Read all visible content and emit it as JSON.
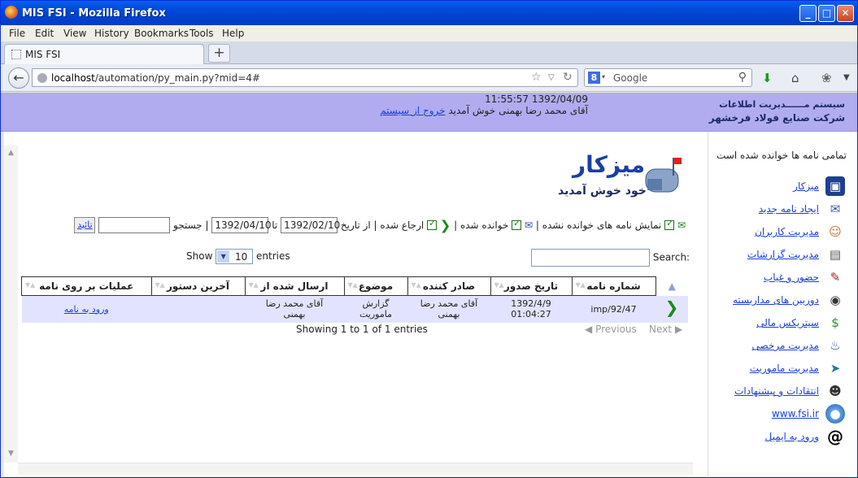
{
  "window": {
    "title": "MIS FSI - Mozilla Firefox",
    "controls": [
      "_",
      "□",
      "✕"
    ]
  },
  "menu": [
    "File",
    "Edit",
    "View",
    "History",
    "Bookmarks",
    "Tools",
    "Help"
  ],
  "tab": {
    "title": "MIS FSI",
    "new_tab": "+"
  },
  "nav": {
    "url_host": "localhost",
    "url_path": "/automation/py_main.py?mid=4#",
    "search_engine": "Google",
    "search_placeholder": "Google"
  },
  "header": {
    "clock": "11:55:57 1392/04/09",
    "welcome": "آقای محمد رضا بهمنی خوش آمدید",
    "logout": "خروج از سیستم",
    "brand_line1": "سیستم مــــــدیریت اطلاعات",
    "brand_line2": "شرکت صنایع فولاد فرخشهر"
  },
  "logo": {
    "title": "میزکار",
    "subtitle": "خود خوش آمدید"
  },
  "filter": {
    "show_unread": "نمایش نامه های خوانده نشده |",
    "read": "خوانده شده |",
    "referred": "ارجاع شده | از تاریخ",
    "from_date": "1392/02/10",
    "to": "تا",
    "to_date": "1392/04/10",
    "search_label": "| جستجو",
    "ok": "تائید"
  },
  "datatable": {
    "show": "Show",
    "page_size": "10",
    "entries": "entries",
    "search_label": "Search:",
    "columns": [
      "شماره نامه",
      "تاریخ صدور",
      "صادر کننده",
      "موضوع",
      "ارسال شده از",
      "آخرین دستور",
      "عملیات بر روی نامه"
    ],
    "rows": [
      {
        "number": "imp/92/47",
        "date1": "1392/4/9",
        "date2": "01:04:27",
        "issuer1": "آقای محمد رضا",
        "issuer2": "بهمنی",
        "subject1": "گزارش",
        "subject2": "ماموریت",
        "sender1": "آقای محمد رضا",
        "sender2": "بهمنی",
        "last": "",
        "action": "ورود به نامه"
      }
    ],
    "info": "Showing 1 to 1 of 1 entries",
    "previous": "Previous",
    "next": "Next"
  },
  "sidebar": {
    "heading": "تمامی نامه ها خوانده شده است",
    "items": [
      {
        "label": "میزکار",
        "icon": "monitor-icon"
      },
      {
        "label": "ایجاد نامه جدید",
        "icon": "envelope-icon"
      },
      {
        "label": "مدیریت کاربران",
        "icon": "users-icon"
      },
      {
        "label": "مدیریت گزارشات",
        "icon": "report-icon"
      },
      {
        "label": "حضور و غیاب",
        "icon": "attendance-icon"
      },
      {
        "label": "دوربین های مداربسته",
        "icon": "camera-icon"
      },
      {
        "label": "سیتریکس مالی",
        "icon": "money-icon"
      },
      {
        "label": "مدیریت مرخصی",
        "icon": "leave-icon"
      },
      {
        "label": "مدیریت ماموریت",
        "icon": "mission-icon"
      },
      {
        "label": "انتقادات و پیشنهادات",
        "icon": "feedback-icon"
      },
      {
        "label": "www.fsi.ir",
        "icon": "globe-icon"
      },
      {
        "label": "ورود به ایمیل",
        "icon": "email-icon"
      }
    ]
  }
}
